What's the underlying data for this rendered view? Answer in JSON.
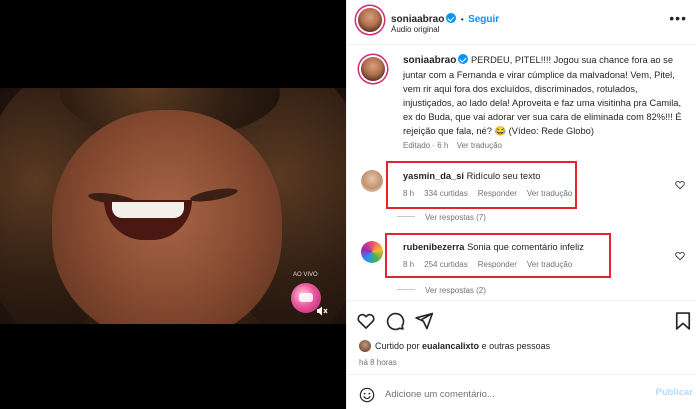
{
  "header": {
    "username": "soniaabrao",
    "follow_label": "Seguir",
    "follow_separator": "•",
    "audio": "Áudio original",
    "more_icon": "more-horizontal-icon"
  },
  "caption": {
    "username": "soniaabrao",
    "text": "PERDEU, PITEL!!!! Jogou sua chance fora ao se juntar com a Fernanda e virar cúmplice da malvadona! Vem, Pitel, vem rir aqui fora dos excluídos, discriminados, rotulados, injustiçados, ao lado dela! Aproveita e faz uma visitinha pra Camila, ex do Buda, que vai adorar ver sua cara de eliminada com 82%!!! É rejeição que fala, né? 😂 (Vídeo: Rede Globo)",
    "edited": "Editado · 6 h",
    "translate": "Ver tradução"
  },
  "comments": [
    {
      "username": "yasmin_da_si",
      "text": "Ridículo seu texto",
      "time": "8 h",
      "likes": "334 curtidas",
      "reply": "Responder",
      "translate": "Ver tradução",
      "replies": "Ver respostas (7)"
    },
    {
      "username": "rubenibezerra",
      "text": "Sonia que comentário infeliz",
      "time": "8 h",
      "likes": "254 curtidas",
      "reply": "Responder",
      "translate": "Ver tradução",
      "replies": "Ver respostas (2)"
    }
  ],
  "video": {
    "live_label": "AO VIVO"
  },
  "footer": {
    "liked_by_prefix": "Curtido por ",
    "liked_by_user": "eualancalixto",
    "liked_by_suffix": " e outras pessoas",
    "time": "há 8 horas",
    "comment_placeholder": "Adicione um comentário...",
    "publish_label": "Publicar"
  },
  "colors": {
    "accent": "#0095f6",
    "highlight": "#e3262d"
  }
}
